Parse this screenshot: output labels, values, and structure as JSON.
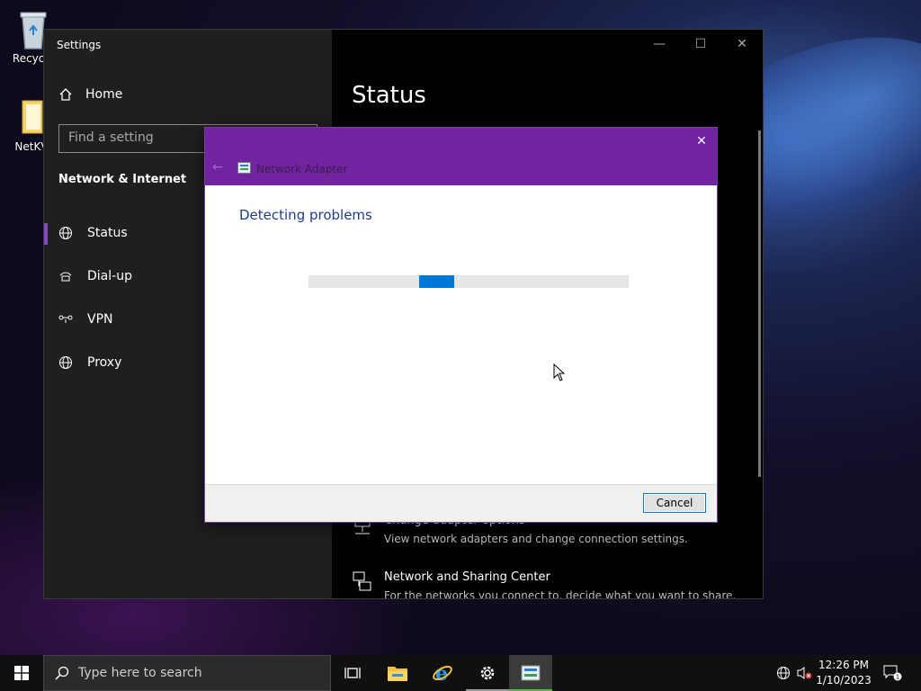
{
  "desktop": {
    "icons": [
      {
        "label": "Recycle",
        "icon": "recycle-bin-icon"
      },
      {
        "label": "NetKV",
        "icon": "folder-icon"
      }
    ]
  },
  "settings": {
    "window_title": "Settings",
    "controls": {
      "minimize": "—",
      "maximize": "☐",
      "close": "✕"
    },
    "home_label": "Home",
    "search_placeholder": "Find a setting",
    "section_title": "Network & Internet",
    "nav": [
      {
        "label": "Status",
        "icon": "globe-icon",
        "active": true
      },
      {
        "label": "Dial-up",
        "icon": "dialup-icon",
        "active": false
      },
      {
        "label": "VPN",
        "icon": "vpn-icon",
        "active": false
      },
      {
        "label": "Proxy",
        "icon": "globe-icon",
        "active": false
      }
    ],
    "main_title": "Status",
    "links": [
      {
        "title": "Change adapter options",
        "desc": "View network adapters and change connection settings.",
        "icon": "adapter-icon"
      },
      {
        "title": "Network and Sharing Center",
        "desc": "For the networks you connect to, decide what you want to share.",
        "icon": "sharing-center-icon"
      }
    ]
  },
  "dialog": {
    "close": "✕",
    "back": "←",
    "title": "Network Adapter",
    "status_text": "Detecting problems",
    "progress_segment_start": 0.345,
    "progress_segment_width": 0.11,
    "cancel_label": "Cancel",
    "accent_color": "#7224a0"
  },
  "taskbar": {
    "search_placeholder": "Type here to search",
    "apps": [
      {
        "name": "task-view-icon"
      },
      {
        "name": "file-explorer-icon"
      },
      {
        "name": "internet-explorer-icon"
      },
      {
        "name": "settings-gear-icon"
      },
      {
        "name": "troubleshooter-icon"
      }
    ],
    "clock": {
      "time": "12:26 PM",
      "date": "1/10/2023"
    },
    "notifications": "1"
  }
}
